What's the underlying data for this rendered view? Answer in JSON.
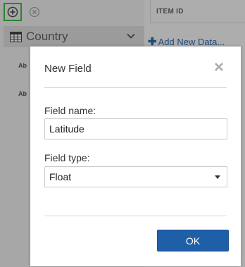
{
  "toolbar": {
    "add_icon": "plus-circle-icon",
    "remove_icon": "x-circle-icon",
    "add_highlight_color": "#2fb52f"
  },
  "sidebar": {
    "table_label": "Country",
    "table_icon": "table-grid-icon",
    "field_type_badges": [
      "Ab",
      "Ab"
    ]
  },
  "grid": {
    "column_header": "ITEM ID",
    "add_new_data_label": "Add New Data..."
  },
  "dialog": {
    "title": "New Field",
    "field_name_label": "Field name:",
    "field_name_value": "Latitude",
    "field_type_label": "Field type:",
    "field_type_value": "Float",
    "ok_label": "OK",
    "ok_color": "#1f5fa8"
  }
}
